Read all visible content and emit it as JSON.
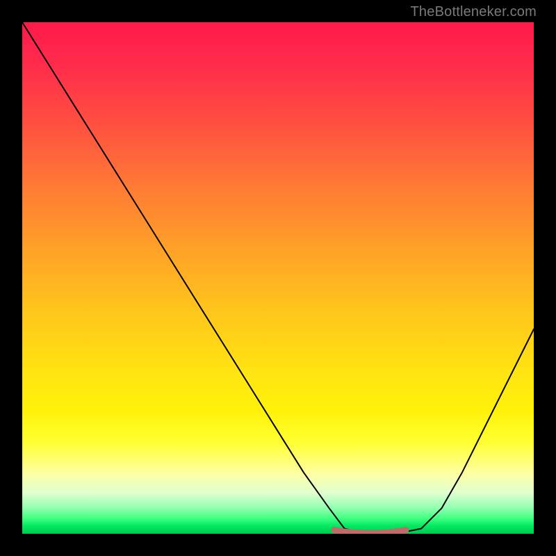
{
  "watermark": "TheBottleneker.com",
  "chart_data": {
    "type": "line",
    "title": "",
    "xlabel": "",
    "ylabel": "",
    "xlim": [
      0,
      100
    ],
    "ylim": [
      0,
      100
    ],
    "background": "red-to-green vertical gradient (bottleneck severity)",
    "series": [
      {
        "name": "bottleneck-curve",
        "x": [
          0,
          5,
          10,
          15,
          20,
          25,
          30,
          35,
          40,
          45,
          50,
          55,
          60,
          63,
          67,
          70,
          73,
          78,
          82,
          86,
          90,
          94,
          98,
          100
        ],
        "values": [
          100,
          92,
          84,
          76,
          68,
          60,
          52,
          44,
          36,
          28,
          20,
          12,
          5,
          1,
          0,
          0,
          0,
          1,
          5,
          12,
          20,
          28,
          36,
          40
        ]
      },
      {
        "name": "optimal-range-marker",
        "x": [
          61,
          63,
          65,
          67,
          69,
          71,
          73,
          75
        ],
        "values": [
          0.7,
          0.4,
          0.2,
          0.1,
          0.1,
          0.2,
          0.4,
          0.7
        ]
      }
    ],
    "colors": {
      "curve": "#000000",
      "marker": "#c26a6a"
    }
  }
}
